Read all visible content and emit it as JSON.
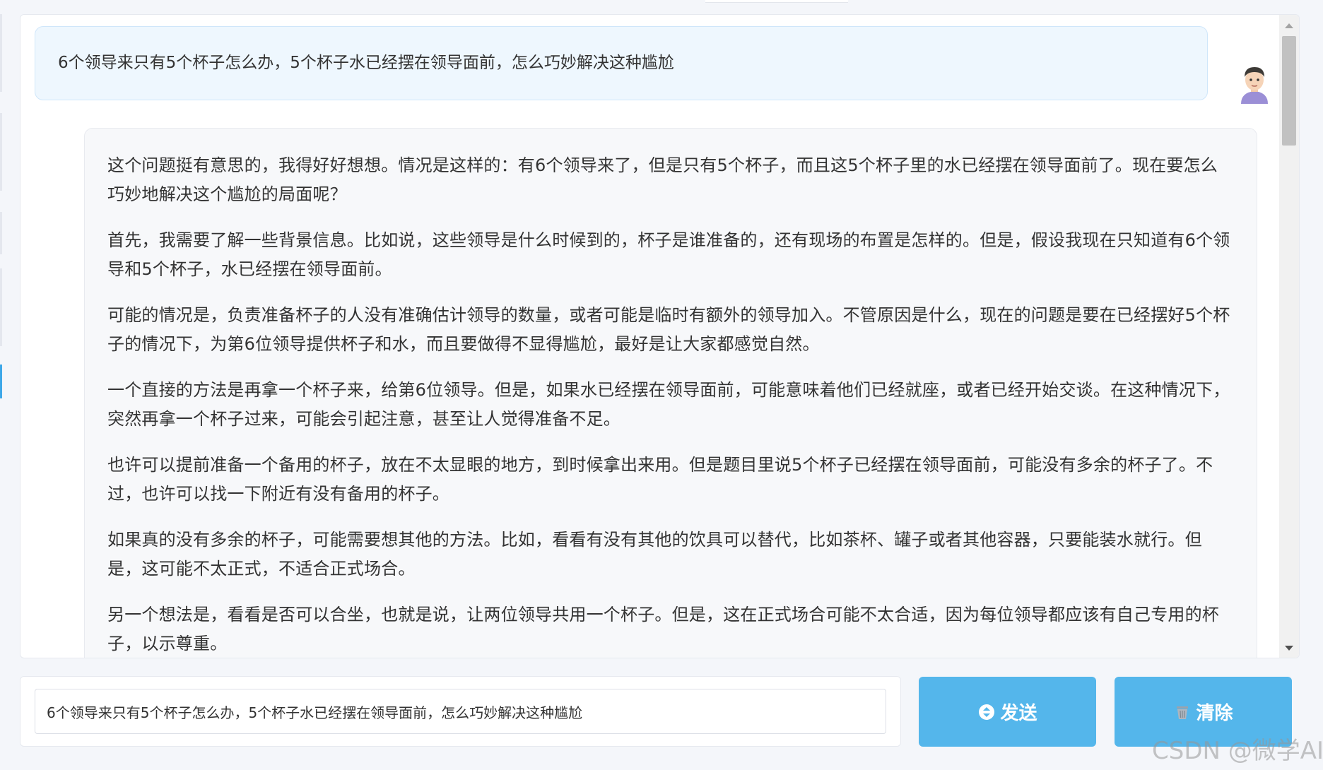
{
  "chat": {
    "user_message": "6个领导来只有5个杯子怎么办，5个杯子水已经摆在领导面前，怎么巧妙解决这种尴尬",
    "assistant_paragraphs": [
      "这个问题挺有意思的，我得好好想想。情况是这样的：有6个领导来了，但是只有5个杯子，而且这5个杯子里的水已经摆在领导面前了。现在要怎么巧妙地解决这个尴尬的局面呢？",
      "首先，我需要了解一些背景信息。比如说，这些领导是什么时候到的，杯子是谁准备的，还有现场的布置是怎样的。但是，假设我现在只知道有6个领导和5个杯子，水已经摆在领导面前。",
      "可能的情况是，负责准备杯子的人没有准确估计领导的数量，或者可能是临时有额外的领导加入。不管原因是什么，现在的问题是要在已经摆好5个杯子的情况下，为第6位领导提供杯子和水，而且要做得不显得尴尬，最好是让大家都感觉自然。",
      "一个直接的方法是再拿一个杯子来，给第6位领导。但是，如果水已经摆在领导面前，可能意味着他们已经就座，或者已经开始交谈。在这种情况下，突然再拿一个杯子过来，可能会引起注意，甚至让人觉得准备不足。",
      "也许可以提前准备一个备用的杯子，放在不太显眼的地方，到时候拿出来用。但是题目里说5个杯子已经摆在领导面前，可能没有多余的杯子了。不过，也许可以找一下附近有没有备用的杯子。",
      "如果真的没有多余的杯子，可能需要想其他的方法。比如，看看有没有其他的饮具可以替代，比如茶杯、罐子或者其他容器，只要能装水就行。但是，这可能不太正式，不适合正式场合。",
      "另一个想法是，看看是否可以合坐，也就是说，让两位领导共用一个杯子。但是，这在正式场合可能不太合适，因为每位领导都应该有自己专用的杯子，以示尊重。"
    ]
  },
  "composer": {
    "input_value": "6个领导来只有5个杯子怎么办，5个杯子水已经摆在领导面前，怎么巧妙解决这种尴尬",
    "send_label": "发送",
    "clear_label": "清除"
  },
  "watermark": "CSDN @微学AI",
  "colors": {
    "button": "#54b6eb",
    "user_bubble": "#eef7fe",
    "assistant_bubble": "#f7f8fa"
  }
}
